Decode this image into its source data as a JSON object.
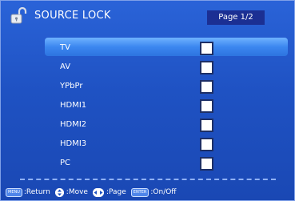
{
  "header": {
    "title": "SOURCE LOCK",
    "page_indicator": "Page 1/2"
  },
  "sources": [
    {
      "label": "TV",
      "locked": false,
      "selected": true
    },
    {
      "label": "AV",
      "locked": false,
      "selected": false
    },
    {
      "label": "YPbPr",
      "locked": false,
      "selected": false
    },
    {
      "label": "HDMI1",
      "locked": false,
      "selected": false
    },
    {
      "label": "HDMI2",
      "locked": false,
      "selected": false
    },
    {
      "label": "HDMI3",
      "locked": false,
      "selected": false
    },
    {
      "label": "PC",
      "locked": false,
      "selected": false
    }
  ],
  "footer": {
    "menu_key": "MENU",
    "return_label": ":Return",
    "move_label": ":Move",
    "page_label": ":Page",
    "enter_key": "ENTER",
    "onoff_label": ":On/Off"
  },
  "icons": {
    "lock": "padlock-icon",
    "move": "up-down-arrows-icon",
    "page": "left-right-arrows-icon"
  }
}
